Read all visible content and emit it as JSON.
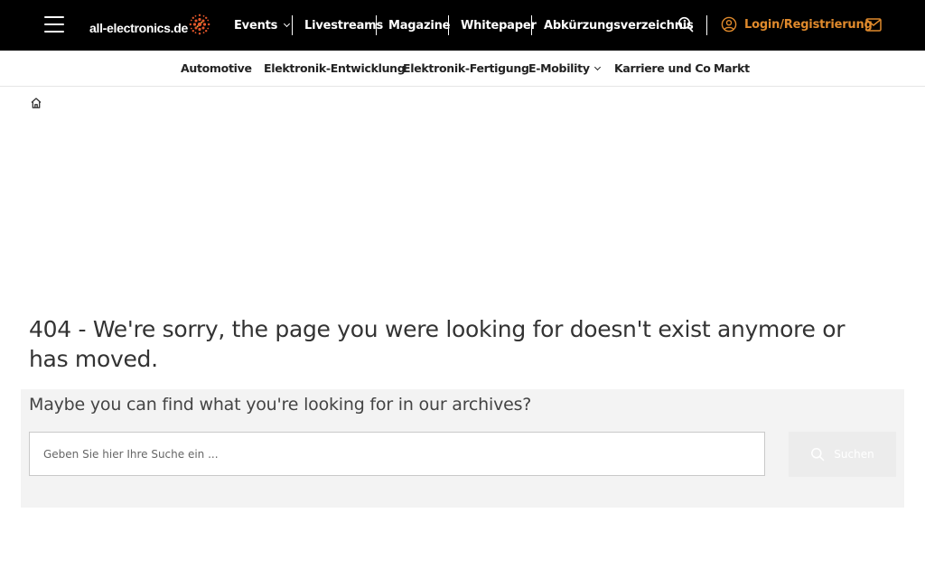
{
  "header": {
    "logo_text": "all-electronics.de",
    "nav": [
      {
        "label": "Events",
        "has_dropdown": true
      },
      {
        "label": "Livestreams"
      },
      {
        "label": "Magazine"
      },
      {
        "label": "Whitepaper"
      },
      {
        "label": "Abkürzungsverzeichnis"
      }
    ],
    "login_label": "Login/Registrierung",
    "icons": [
      "menu-icon",
      "search-icon",
      "user-icon",
      "mail-icon"
    ],
    "colors": {
      "background": "#000000",
      "accent": "#e08a2c",
      "text": "#ffffff"
    }
  },
  "subnav": {
    "items": [
      {
        "label": "Automotive"
      },
      {
        "label": "Elektronik-Entwicklung"
      },
      {
        "label": "Elektronik-Fertigung"
      },
      {
        "label": "E-Mobility",
        "has_dropdown": true
      },
      {
        "label": "Karriere und Co"
      },
      {
        "label": "Markt"
      }
    ]
  },
  "breadcrumb": {
    "icon": "home-icon"
  },
  "main": {
    "error_heading": "404 - We're sorry, the page you were looking for doesn't exist anymore or has moved.",
    "archive": {
      "title": "Maybe you can find what you're looking for in our archives?",
      "search_placeholder": "Geben Sie hier Ihre Suche ein ...",
      "search_value": "",
      "search_button_label": "Suchen"
    }
  }
}
